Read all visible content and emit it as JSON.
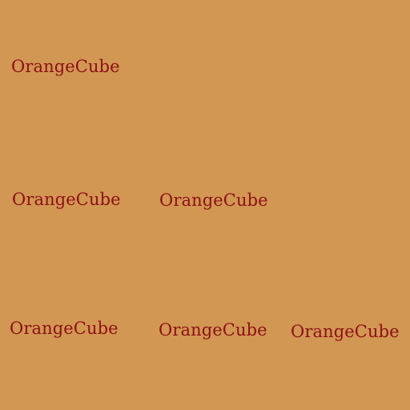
{
  "colors": {
    "background": "#d29752",
    "text": "#8e0f18"
  },
  "labels": [
    "OrangeCube",
    "OrangeCube",
    "OrangeCube",
    "OrangeCube",
    "OrangeCube",
    "OrangeCube"
  ]
}
